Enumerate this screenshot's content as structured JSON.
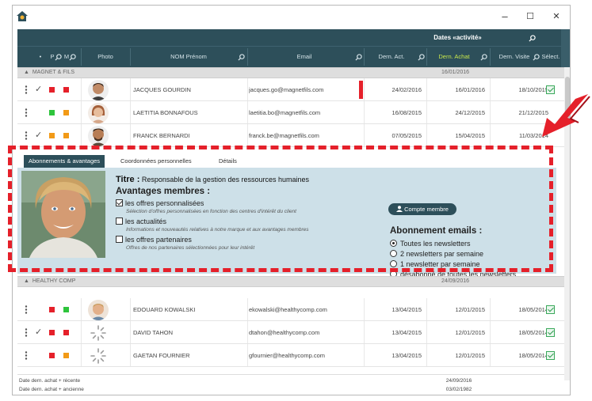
{
  "window": {
    "controls": {
      "minimize": "–",
      "maximize": "☐",
      "close": "✕"
    }
  },
  "header": {
    "dates_group_label": "Dates «activité»",
    "columns": {
      "photo": "Photo",
      "name": "NOM Prénom",
      "email": "Email",
      "last_activity": "Dern. Act.",
      "last_purchase": "Dern. Achat",
      "last_visit": "Dern. Visite",
      "select": "Sélect."
    },
    "flag_cols": [
      "P",
      "M"
    ]
  },
  "groups": [
    {
      "name": "MAGNET & FILS",
      "date": "16/01/2016",
      "rows": [
        {
          "name": "JACQUES GOURDIN",
          "email": "jacques.go@magnetfils.com",
          "d1": "24/02/2016",
          "d2": "16/01/2016",
          "d3": "18/10/2015",
          "check": "✓",
          "sq1": "#e5202a",
          "sq2": "#e5202a",
          "selected": true
        },
        {
          "name": "LAETITIA BONNAFOUS",
          "email": "laetitia.bo@magnetfils.com",
          "d1": "16/08/2015",
          "d2": "24/12/2015",
          "d3": "21/12/2015",
          "check": "",
          "sq1": "#2ec43c",
          "sq2": "#f29a17",
          "selected": false
        },
        {
          "name": "FRANCK BERNARDI",
          "email": "franck.be@magnetfils.com",
          "d1": "07/05/2015",
          "d2": "15/04/2015",
          "d3": "11/03/2014",
          "check": "✓",
          "sq1": "#f29a17",
          "sq2": "#f29a17",
          "selected": false
        }
      ]
    },
    {
      "name": "HEALTHY COMP",
      "date": "24/09/2016",
      "rows": [
        {
          "name": "EDOUARD KOWALSKI",
          "email": "ekowalski@healthycomp.com",
          "d1": "13/04/2015",
          "d2": "12/01/2015",
          "d3": "18/05/2014",
          "check": "",
          "sq1": "#e5202a",
          "sq2": "#2ec43c",
          "selected": true
        },
        {
          "name": "DAVID TAHON",
          "email": "dtahon@healthycomp.com",
          "d1": "13/04/2015",
          "d2": "12/01/2015",
          "d3": "18/05/2014",
          "check": "✓",
          "sq1": "#e5202a",
          "sq2": "#e5202a",
          "selected": true
        },
        {
          "name": "GAETAN FOURNIER",
          "email": "gfournier@healthycomp.com",
          "d1": "13/04/2015",
          "d2": "12/01/2015",
          "d3": "18/05/2014",
          "check": "",
          "sq1": "#e5202a",
          "sq2": "#f29a17",
          "selected": true
        }
      ]
    }
  ],
  "detail": {
    "tabs": [
      "Abonnements & avantages",
      "Coordonnées personnelles",
      "Détails"
    ],
    "active_tab": 0,
    "title_label": "Titre :",
    "title_value": "Responsable de la gestion des ressources humaines",
    "avantages_title": "Avantages membres :",
    "avantages": [
      {
        "label": "les offres personnalisées",
        "checked": true,
        "desc": "Sélection d'offres personnalisées en fonction des centres d'intérêt du client"
      },
      {
        "label": "les actualités",
        "checked": false,
        "desc": "Informations et nouveautés relatives à notre marque et aux avantages membres"
      },
      {
        "label": "les offres partenaires",
        "checked": false,
        "desc": "Offres de nos partenaires sélectionnées pour leur intérêt"
      }
    ],
    "compte_button": "Compte membre",
    "abonnement_title": "Abonnement emails :",
    "newsletter_options": [
      {
        "label": "Toutes les newsletters",
        "selected": true
      },
      {
        "label": "2 newsletters par semaine",
        "selected": false
      },
      {
        "label": "1 newsletter par semaine",
        "selected": false
      },
      {
        "label": "désabonné de toutes les newsletters",
        "selected": false
      }
    ]
  },
  "footer": {
    "recent_label": "Date dern. achat + récente",
    "recent_value": "24/09/2016",
    "oldest_label": "Date dern. achat + ancienne",
    "oldest_value": "03/02/1982"
  },
  "colors": {
    "header_bg": "#2d4f5a",
    "accent_column": "#c9e74b",
    "highlight_red": "#e5202a",
    "detail_bg": "#cde0e8",
    "select_green": "#39a85a"
  }
}
